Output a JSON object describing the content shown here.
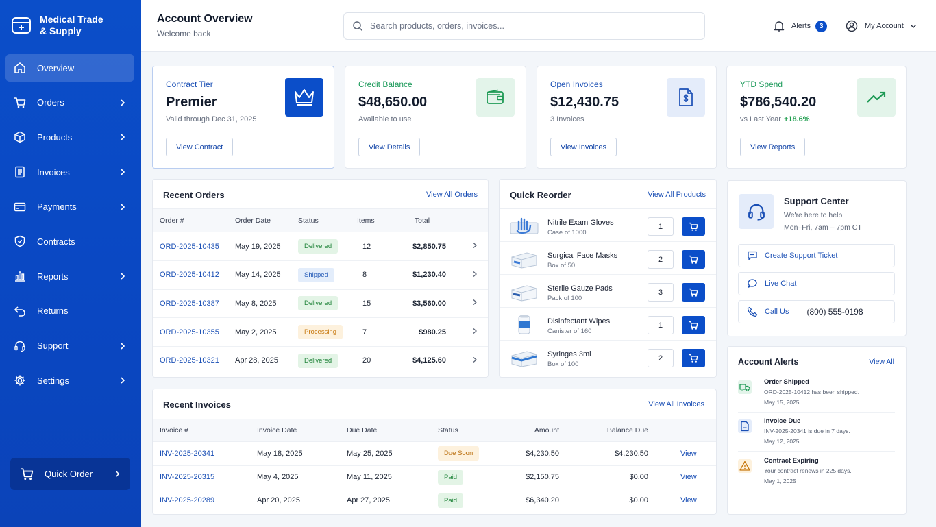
{
  "brand": {
    "name_line1": "Medical Trade",
    "name_line2": "& Supply"
  },
  "sidebar": {
    "items": [
      {
        "label": "Overview",
        "icon": "home-icon",
        "chevron": false,
        "active": true
      },
      {
        "label": "Orders",
        "icon": "cart-icon",
        "chevron": true
      },
      {
        "label": "Products",
        "icon": "box-icon",
        "chevron": true
      },
      {
        "label": "Invoices",
        "icon": "document-icon",
        "chevron": true
      },
      {
        "label": "Payments",
        "icon": "card-icon",
        "chevron": true
      },
      {
        "label": "Contracts",
        "icon": "shield-icon",
        "chevron": false
      },
      {
        "label": "Reports",
        "icon": "bar-chart-icon",
        "chevron": true
      },
      {
        "label": "Returns",
        "icon": "return-icon",
        "chevron": false
      },
      {
        "label": "Support",
        "icon": "headset-icon",
        "chevron": true
      },
      {
        "label": "Settings",
        "icon": "gear-icon",
        "chevron": true
      }
    ],
    "quick_order": "Quick Order"
  },
  "header": {
    "title": "Account Overview",
    "subtitle": "Welcome back",
    "search_placeholder": "Search products, orders, invoices...",
    "alerts_label": "Alerts",
    "alerts_count": "3",
    "account_label": "My Account"
  },
  "stats": {
    "contract": {
      "label": "Contract Tier",
      "value": "Premier",
      "sub": "Valid through Dec 31, 2025",
      "button": "View Contract"
    },
    "credit": {
      "label": "Credit Balance",
      "value": "$48,650.00",
      "sub": "Available to use",
      "button": "View Details"
    },
    "invoices": {
      "label": "Open Invoices",
      "value": "$12,430.75",
      "sub": "3 Invoices",
      "button": "View Invoices"
    },
    "spend": {
      "label": "YTD Spend",
      "value": "$786,540.20",
      "sub": "vs Last Year",
      "change": "+18.6%",
      "button": "View Reports"
    }
  },
  "recent_orders": {
    "title": "Recent Orders",
    "link": "View All Orders",
    "columns": [
      "Order #",
      "Order Date",
      "Status",
      "Items",
      "Total"
    ],
    "rows": [
      {
        "id": "ORD-2025-10435",
        "date": "May 19, 2025",
        "status": "Delivered",
        "items": "12",
        "total": "$2,850.75"
      },
      {
        "id": "ORD-2025-10412",
        "date": "May 14, 2025",
        "status": "Shipped",
        "items": "8",
        "total": "$1,230.40"
      },
      {
        "id": "ORD-2025-10387",
        "date": "May 8, 2025",
        "status": "Delivered",
        "items": "15",
        "total": "$3,560.00"
      },
      {
        "id": "ORD-2025-10355",
        "date": "May 2, 2025",
        "status": "Processing",
        "items": "7",
        "total": "$980.25"
      },
      {
        "id": "ORD-2025-10321",
        "date": "Apr 28, 2025",
        "status": "Delivered",
        "items": "20",
        "total": "$4,125.60"
      }
    ]
  },
  "quick_reorder": {
    "title": "Quick Reorder",
    "link": "View All Products",
    "items": [
      {
        "name": "Nitrile Exam Gloves",
        "pack": "Case of 1000",
        "qty": "1"
      },
      {
        "name": "Surgical Face Masks",
        "pack": "Box of 50",
        "qty": "2"
      },
      {
        "name": "Sterile Gauze Pads",
        "pack": "Pack of 100",
        "qty": "3"
      },
      {
        "name": "Disinfectant Wipes",
        "pack": "Canister of 160",
        "qty": "1"
      },
      {
        "name": "Syringes 3ml",
        "pack": "Box of 100",
        "qty": "2"
      }
    ]
  },
  "support": {
    "title": "Support Center",
    "line1": "We're here to help",
    "line2": "Mon–Fri, 7am – 7pm CT",
    "ticket": "Create Support Ticket",
    "chat": "Live Chat",
    "call": "Call Us",
    "phone": "(800) 555-0198"
  },
  "recent_invoices": {
    "title": "Recent Invoices",
    "link": "View All Invoices",
    "columns": [
      "Invoice #",
      "Invoice Date",
      "Due Date",
      "Status",
      "Amount",
      "Balance Due"
    ],
    "rows": [
      {
        "id": "INV-2025-20341",
        "date": "May 18, 2025",
        "due": "May 25, 2025",
        "status": "Due Soon",
        "amount": "$4,230.50",
        "balance": "$4,230.50",
        "action": "View"
      },
      {
        "id": "INV-2025-20315",
        "date": "May 4, 2025",
        "due": "May 11, 2025",
        "status": "Paid",
        "amount": "$2,150.75",
        "balance": "$0.00",
        "action": "View"
      },
      {
        "id": "INV-2025-20289",
        "date": "Apr 20, 2025",
        "due": "Apr 27, 2025",
        "status": "Paid",
        "amount": "$6,340.20",
        "balance": "$0.00",
        "action": "View"
      }
    ]
  },
  "account_alerts": {
    "title": "Account Alerts",
    "link": "View All",
    "items": [
      {
        "title": "Order Shipped",
        "text": "ORD-2025-10412 has been shipped.",
        "date": "May 15, 2025"
      },
      {
        "title": "Invoice Due",
        "text": "INV-2025-20341 is due in 7 days.",
        "date": "May 12, 2025"
      },
      {
        "title": "Contract Expiring",
        "text": "Your contract renews in 225 days.",
        "date": "May 1, 2025"
      }
    ]
  }
}
